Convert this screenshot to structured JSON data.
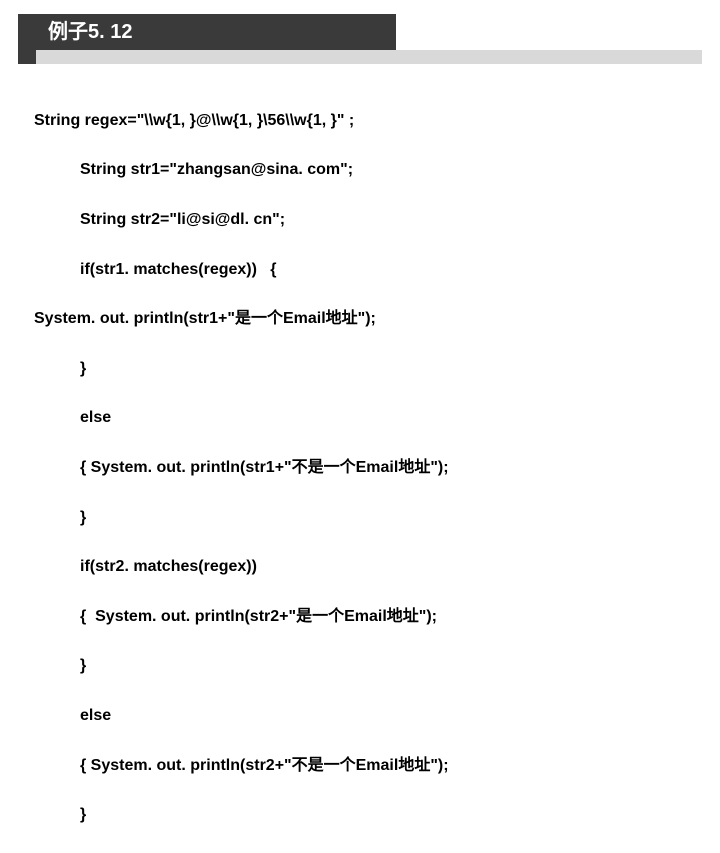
{
  "header": {
    "title": "例子5. 12"
  },
  "code": {
    "l1": "String regex=\"\\\\w{1, }@\\\\w{1, }\\56\\\\w{1, }\" ;",
    "l2": "String str1=\"zhangsan@sina. com\";",
    "l3": "String str2=\"li@si@dl. cn\";",
    "l4": "if(str1. matches(regex))   {",
    "l5": "System. out. println(str1+\"是一个Email地址\");",
    "l6": "}",
    "l7": "else",
    "l8": "{ System. out. println(str1+\"不是一个Email地址\");",
    "l9": "}",
    "l10": "if(str2. matches(regex))",
    "l11": "{  System. out. println(str2+\"是一个Email地址\");",
    "l12": "}",
    "l13": "else",
    "l14": "{ System. out. println(str2+\"不是一个Email地址\");",
    "l15": "}"
  }
}
